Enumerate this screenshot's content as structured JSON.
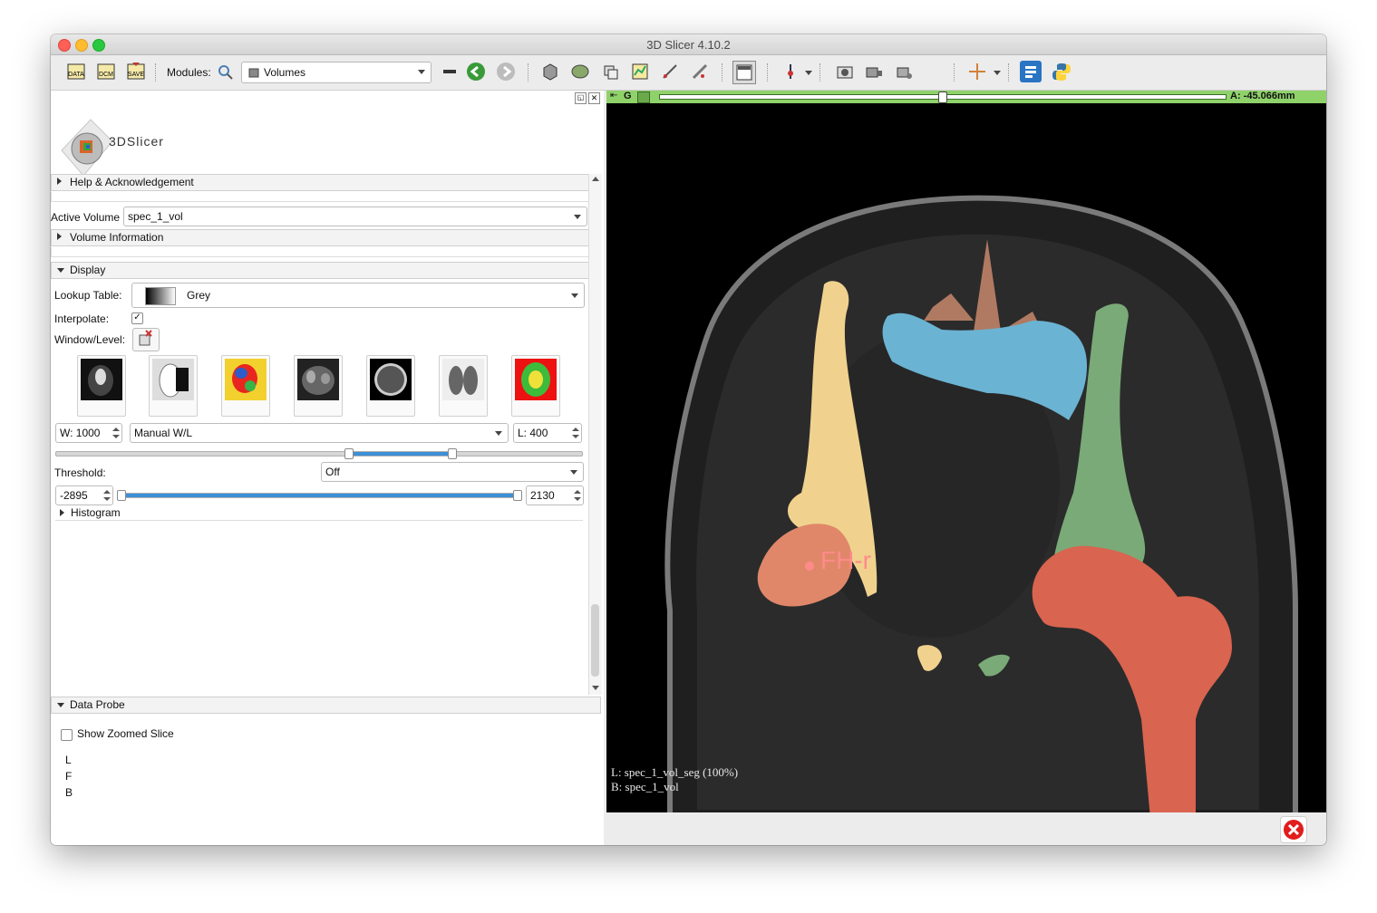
{
  "window": {
    "title": "3D Slicer 4.10.2"
  },
  "toolbar": {
    "data_label": "DATA",
    "dcm_label": "DCM",
    "save_label": "SAVE",
    "modules_label": "Modules:",
    "module_selected": "Volumes"
  },
  "logo": {
    "text": "3DSlicer"
  },
  "sections": {
    "help": "Help & Acknowledgement",
    "active_volume_label": "Active Volume",
    "active_volume_value": "spec_1_vol",
    "volume_info": "Volume Information",
    "display": "Display",
    "data_probe": "Data Probe"
  },
  "display": {
    "lookup_table_label": "Lookup Table:",
    "lookup_table_value": "Grey",
    "interpolate_label": "Interpolate:",
    "interpolate_check": "✓",
    "window_level_label": "Window/Level:",
    "window_value": "W: 1000",
    "wl_mode": "Manual W/L",
    "level_value": "L: 400",
    "threshold_label": "Threshold:",
    "threshold_mode": "Off",
    "threshold_min": "-2895",
    "threshold_max": "2130",
    "histogram_label": "Histogram"
  },
  "data_probe": {
    "show_zoomed_label": "Show Zoomed Slice",
    "rows": [
      "L",
      "F",
      "B"
    ]
  },
  "viewer": {
    "view_name": "G",
    "offset_readout": "A: -45.066mm",
    "slice_offset_fraction": 0.5,
    "annotation_label": "FH-r",
    "corner_line_1": "L: spec_1_vol_seg (100%)",
    "corner_line_2": "B: spec_1_vol",
    "colors": {
      "bar": "#8fd26a",
      "femoral_head_right": "#e0876a",
      "femur_left": "#d9644f",
      "yellow_bone": "#f0d28e",
      "green_bone": "#7aaa78",
      "blue_region": "#6bb3d3",
      "brown_region": "#b07a62"
    }
  }
}
